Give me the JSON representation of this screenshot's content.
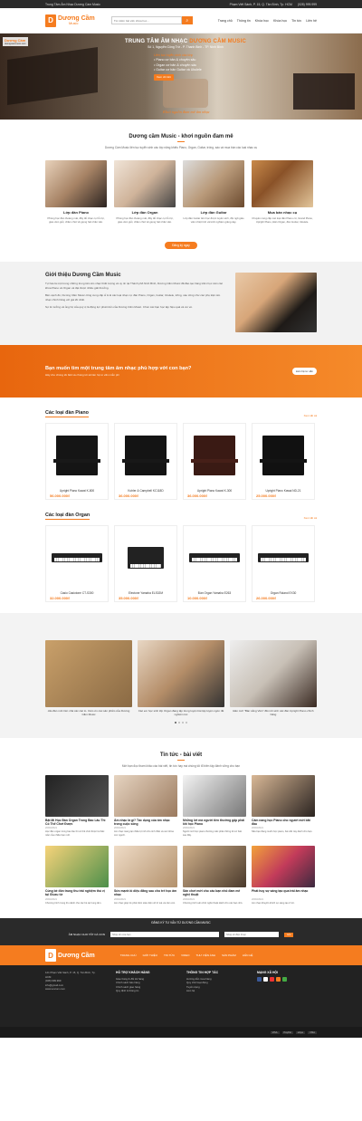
{
  "topbar": {
    "left": "Trung Tâm Âm Nhạc Dương Cầm Music",
    "address": "Phạm Viết Sánh, P. 15, Q. Tân Bình, Tp. HCM",
    "phone": "(028) 999.999"
  },
  "header": {
    "logo_mark": "D",
    "logo_name": "Dương Cầm",
    "logo_sub": "Music",
    "search_placeholder": "Tìm kiếm bài viết, khóa học...",
    "nav": [
      "Trang chủ",
      "Thông tin",
      "Khóa học",
      "Khóa học",
      "Tin tức",
      "Liên hệ"
    ]
  },
  "hero": {
    "corner_logo": "Dương Cầm",
    "corner_url": "duongcammusic.com",
    "title_prefix": "TRUNG TÂM ÂM NHẠC",
    "title_brand": "DƯƠNG CẦM MUSIC",
    "address": "Số 1, Nguyễn Công Trứ - P. Thanh Bình - TP. Ninh Bình",
    "lines": [
      "Liên tục tuyển sinh các lớp",
      "• Piano cơ bản & chuyên sâu",
      "• Organ cơ bản & chuyên sâu",
      "• Guitar cơ bản Guitar và Ukulele"
    ],
    "cta": "Xem chi tiết",
    "slogan": "Khơi nguồn đam mê âm nhạc"
  },
  "intro_section": {
    "title": "Dương cầm Music - khơi nguồn đam mê",
    "subtitle": "Dương Cầm Music liên tục tuyển sinh các lớp năng khiếu Piano, Organ, Guitar, trống, sáo và mua bán các loại nhạc cụ"
  },
  "courses": [
    {
      "name": "Lớp đàn Piano",
      "desc": "Phòng học đàn thoáng mát, đầy đủ nhạc cụ hỗ trợ, giáo viên giỏi, chăm chút về giọng hát nhân văn."
    },
    {
      "name": "Lớp đàn Organ",
      "desc": "Phòng học đàn thoáng mát, đầy đủ nhạc cụ hỗ trợ, giáo viên giỏi, chăm chút về giọng hát nhân văn."
    },
    {
      "name": "Lớp đàn Guitar",
      "desc": "Lớp đàn Guitar tiên học được tuyển sinh, đội ngũ giáo viên nhiệt tình và kinh nghiệm giảng dạy."
    },
    {
      "name": "Mua bán nhạc cụ",
      "desc": "Chuyên cung cấp các loại đàn Piano cơ, Grand Piano, Upright Piano, Đàn Organ, đàn Guitar, Ukulele."
    }
  ],
  "courses_button": "Đăng ký ngay",
  "about": {
    "title": "Giới thiệu Dương Cầm Music",
    "p1": "Tự hào là một trong những trung tâm âm nhạc thiết lượng và uy tín tại Thành phố Ninh Bình, Dương Cầm Music đã đào tạo hàng trăm học viên các khóa Piano và Organ và đạt được nhiều giải thưởng.",
    "p2": "Bên cạnh đó, Dương Cầm Music cũng cung cấp sỉ & lẻ các loại nhạc cụ: đàn Piano, Organ, Guitar, Ukulele, trống, sáo cũng như các phụ kiện âm nhạc chính hãng với giá tốt nhất.",
    "p3": "Sự tin tưởng và ủng hộ của quý vị là động lực phát triển của Dương Cầm Music. Chúc các bạn học tập hiệu quả và vui vẻ."
  },
  "band": {
    "title": "Bạn muốn tìm một trung tâm âm nhạc phù hợp với con bạn?",
    "text": "Hãy cho chúng tôi biết và chúng tôi sẽ liên hệ tư vấn miễn phí",
    "button": "Liên hệ tư vấn"
  },
  "pianos": {
    "title": "Các loại đàn Piano",
    "more": "Xem tất cả",
    "items": [
      {
        "name": "Upright Piano Kawai K-800",
        "price": "56.000.000₫",
        "color": "#151515"
      },
      {
        "name": "Kohler & Campbell KC118D",
        "price": "36.000.000₫",
        "color": "#141414"
      },
      {
        "name": "Upright Piano Kawai K-300",
        "price": "36.000.000₫",
        "color": "#3a1a14"
      },
      {
        "name": "Upright Piano Kawai ND-21",
        "price": "25.000.000₫",
        "color": "#111"
      }
    ]
  },
  "organs": {
    "title": "Các loại đàn Organ",
    "more": "Xem tất cả",
    "items": [
      {
        "name": "Casio Casiotone CT-S300",
        "price": "32.000.000₫"
      },
      {
        "name": "Electone Yamaha ELS02M",
        "price": "35.000.000₫"
      },
      {
        "name": "Đàn Organ Yamaha E263",
        "price": "10.000.000₫"
      },
      {
        "name": "Organ Roland EX30",
        "price": "26.000.000₫"
      }
    ]
  },
  "gallery": [
    {
      "caption": "cấu đàn mới trên nhà các các lo. Cảm ơn các sản phẩm của Dương Cầm Music"
    },
    {
      "caption": "Các em học sinh lớp Organ đang tập trung luyện bài tập luyện ngón rất nghiêm túc"
    },
    {
      "caption": "Đàn mới \"Bàn Lắng Viên\" đã mới sinh các đàn Upright Piano chính hãng"
    }
  ],
  "news_section": {
    "title": "Tin tức - bài viết",
    "subtitle": "Mời bạn đọc tham khảo các bài viết, tin tức hay mà chúng tôi tổ biên tập đánh vững cho bạn"
  },
  "news": [
    {
      "title": "Bật Mí Học Đàn Organ Trong Bao Lâu Thì Có Thể Chơi Được",
      "date": "20/03/2021",
      "text": "Học đàn organ trong bao lâu thì có thể chơi được là thắc mắc của nhiều bạn mới."
    },
    {
      "title": "Âm nhạc là gì? Tác dụng của âm nhạc trong cuộc sống",
      "date": "20/03/2021",
      "text": "Âm nhạc mang lại nhiều lợi ích cho tinh thần và sức khỏe con người."
    },
    {
      "title": "Những lời mà người tiền thường gặp phải khi học Piano",
      "date": "20/03/2021",
      "text": "Người mới học piano thường mắc phải những lỗi cơ bản sau đây."
    },
    {
      "title": "Cảm nang học Piano cho người mới bắt đầu",
      "date": "20/03/2021",
      "text": "Nếu bạn đang muốn học piano, bài viết này dành cho bạn."
    },
    {
      "title": "Cùng bé đón trung thu trải nghiệm thú vị tại Gluxu tứ",
      "date": "20/03/2021",
      "text": "Chương trình trung thu dành cho các bé tại trung tâm."
    },
    {
      "title": "Sức mạnh kì diệu đằng sau cho trẻ học âm nhạc",
      "date": "20/03/2021",
      "text": "Âm nhạc giúp trẻ phát triển toàn diện về trí tuệ và cảm xúc."
    },
    {
      "title": "Sân chơi mới cho các bạn nhỏ đam mê nghệ thuật",
      "date": "20/03/2021",
      "text": "Chương trình sân chơi nghệ thuật dành cho các bạn nhỏ."
    },
    {
      "title": "Phát huy sự sáng tạo qua trái âm nhạc",
      "date": "20/03/2021",
      "text": "Âm nhạc khuyến khích sự sáng tạo ở trẻ."
    }
  ],
  "footer": {
    "newsletter_title": "ĐĂNG KÝ TƯ VẤN TỪ DƯƠNG CẦM MUSIC",
    "newsletter_label": "ÂM NHẠC CHO TẤT CẢ CON",
    "newsletter_placeholder": "Nhập tên của bạn",
    "newsletter_placeholder2": "Nhập số điện thoại",
    "newsletter_button": "Gửi",
    "links": [
      "TRANG CHỦ",
      "GIỚI THIỆU",
      "TIN TỨC",
      "VIDEO",
      "THƯ VIỆN ẢNH",
      "SẢN PHẨM",
      "LIÊN HỆ"
    ],
    "contact": [
      "121 Phạm Viết Sánh, P. 15, Q. Tân Bình, Tp. HCM",
      "(028) 999.999",
      "info@gmail.com",
      "www.tencom.com"
    ],
    "col2_title": "HỖ TRỢ KHÁCH HÀNG",
    "col2": [
      "Giao hàng & đổi trả hàng",
      "Chính sách bảo hàng",
      "Chính sách giao hàng",
      "Quy định & thông tin"
    ],
    "col3_title": "THÔNG TIN HỢP TÁC",
    "col3": [
      "Hướng dẫn mua hàng",
      "Quy chế hoạt động",
      "Tuyển dụng",
      "Liên hệ"
    ],
    "col4_title": "MẠNG XÃ HỘI",
    "payments": [
      "VISA",
      "PayPal",
      "stripe",
      "VISA"
    ]
  }
}
